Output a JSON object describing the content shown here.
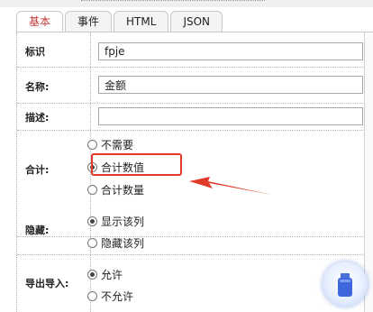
{
  "tabs": [
    {
      "label": "基本",
      "active": true
    },
    {
      "label": "事件",
      "active": false
    },
    {
      "label": "HTML",
      "active": false
    },
    {
      "label": "JSON",
      "active": false
    }
  ],
  "fields": {
    "identifier": {
      "label": "标识",
      "value": "fpje"
    },
    "name": {
      "label": "名称:",
      "value": "金额"
    },
    "description": {
      "label": "描述:",
      "value": ""
    },
    "total": {
      "label": "合计:",
      "options": [
        "不需要",
        "合计数值",
        "合计数量"
      ],
      "selected": "合计数值"
    },
    "hidden": {
      "label": "隐藏:",
      "options": [
        "显示该列",
        "隐藏该列"
      ],
      "selected": "显示该列"
    },
    "import_export": {
      "label": "导出导入:",
      "options": [
        "允许",
        "不允许"
      ],
      "selected": "允许"
    }
  },
  "annotation": {
    "color": "#e23a2a",
    "highlights": "合计数值"
  },
  "floating_button": {
    "icon": "usb-drive-icon"
  }
}
